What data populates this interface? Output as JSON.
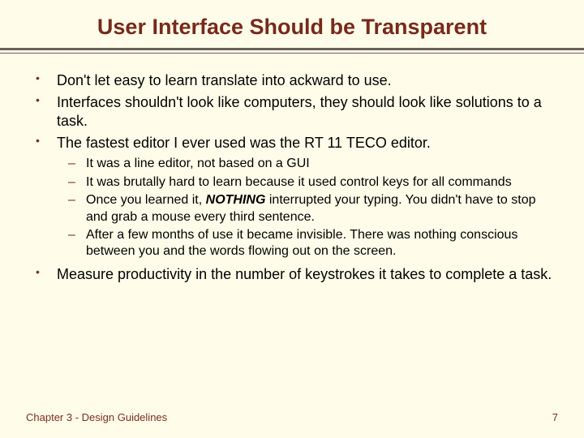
{
  "title": "User Interface Should be Transparent",
  "bullets": {
    "b1": "Don't let easy to learn translate into ackward to use.",
    "b2": "Interfaces shouldn't look like computers, they should look like solutions to a task.",
    "b3": "The fastest editor I ever used was the RT 11 TECO editor.",
    "b3_sub": {
      "s1": "It was a line editor, not based on a GUI",
      "s2": "It was brutally hard to learn because it used control keys for all commands",
      "s3_pre": "Once you learned it, ",
      "s3_em": "NOTHING",
      "s3_post": " interrupted your typing.  You didn't have to stop and grab a mouse every third sentence.",
      "s4": "After a few months of use it became invisible.  There was nothing conscious between you and the words flowing out on the screen."
    },
    "b4": "Measure productivity in the number of keystrokes it takes to complete a task."
  },
  "footer": {
    "left": "Chapter 3 - Design Guidelines",
    "right": "7"
  }
}
